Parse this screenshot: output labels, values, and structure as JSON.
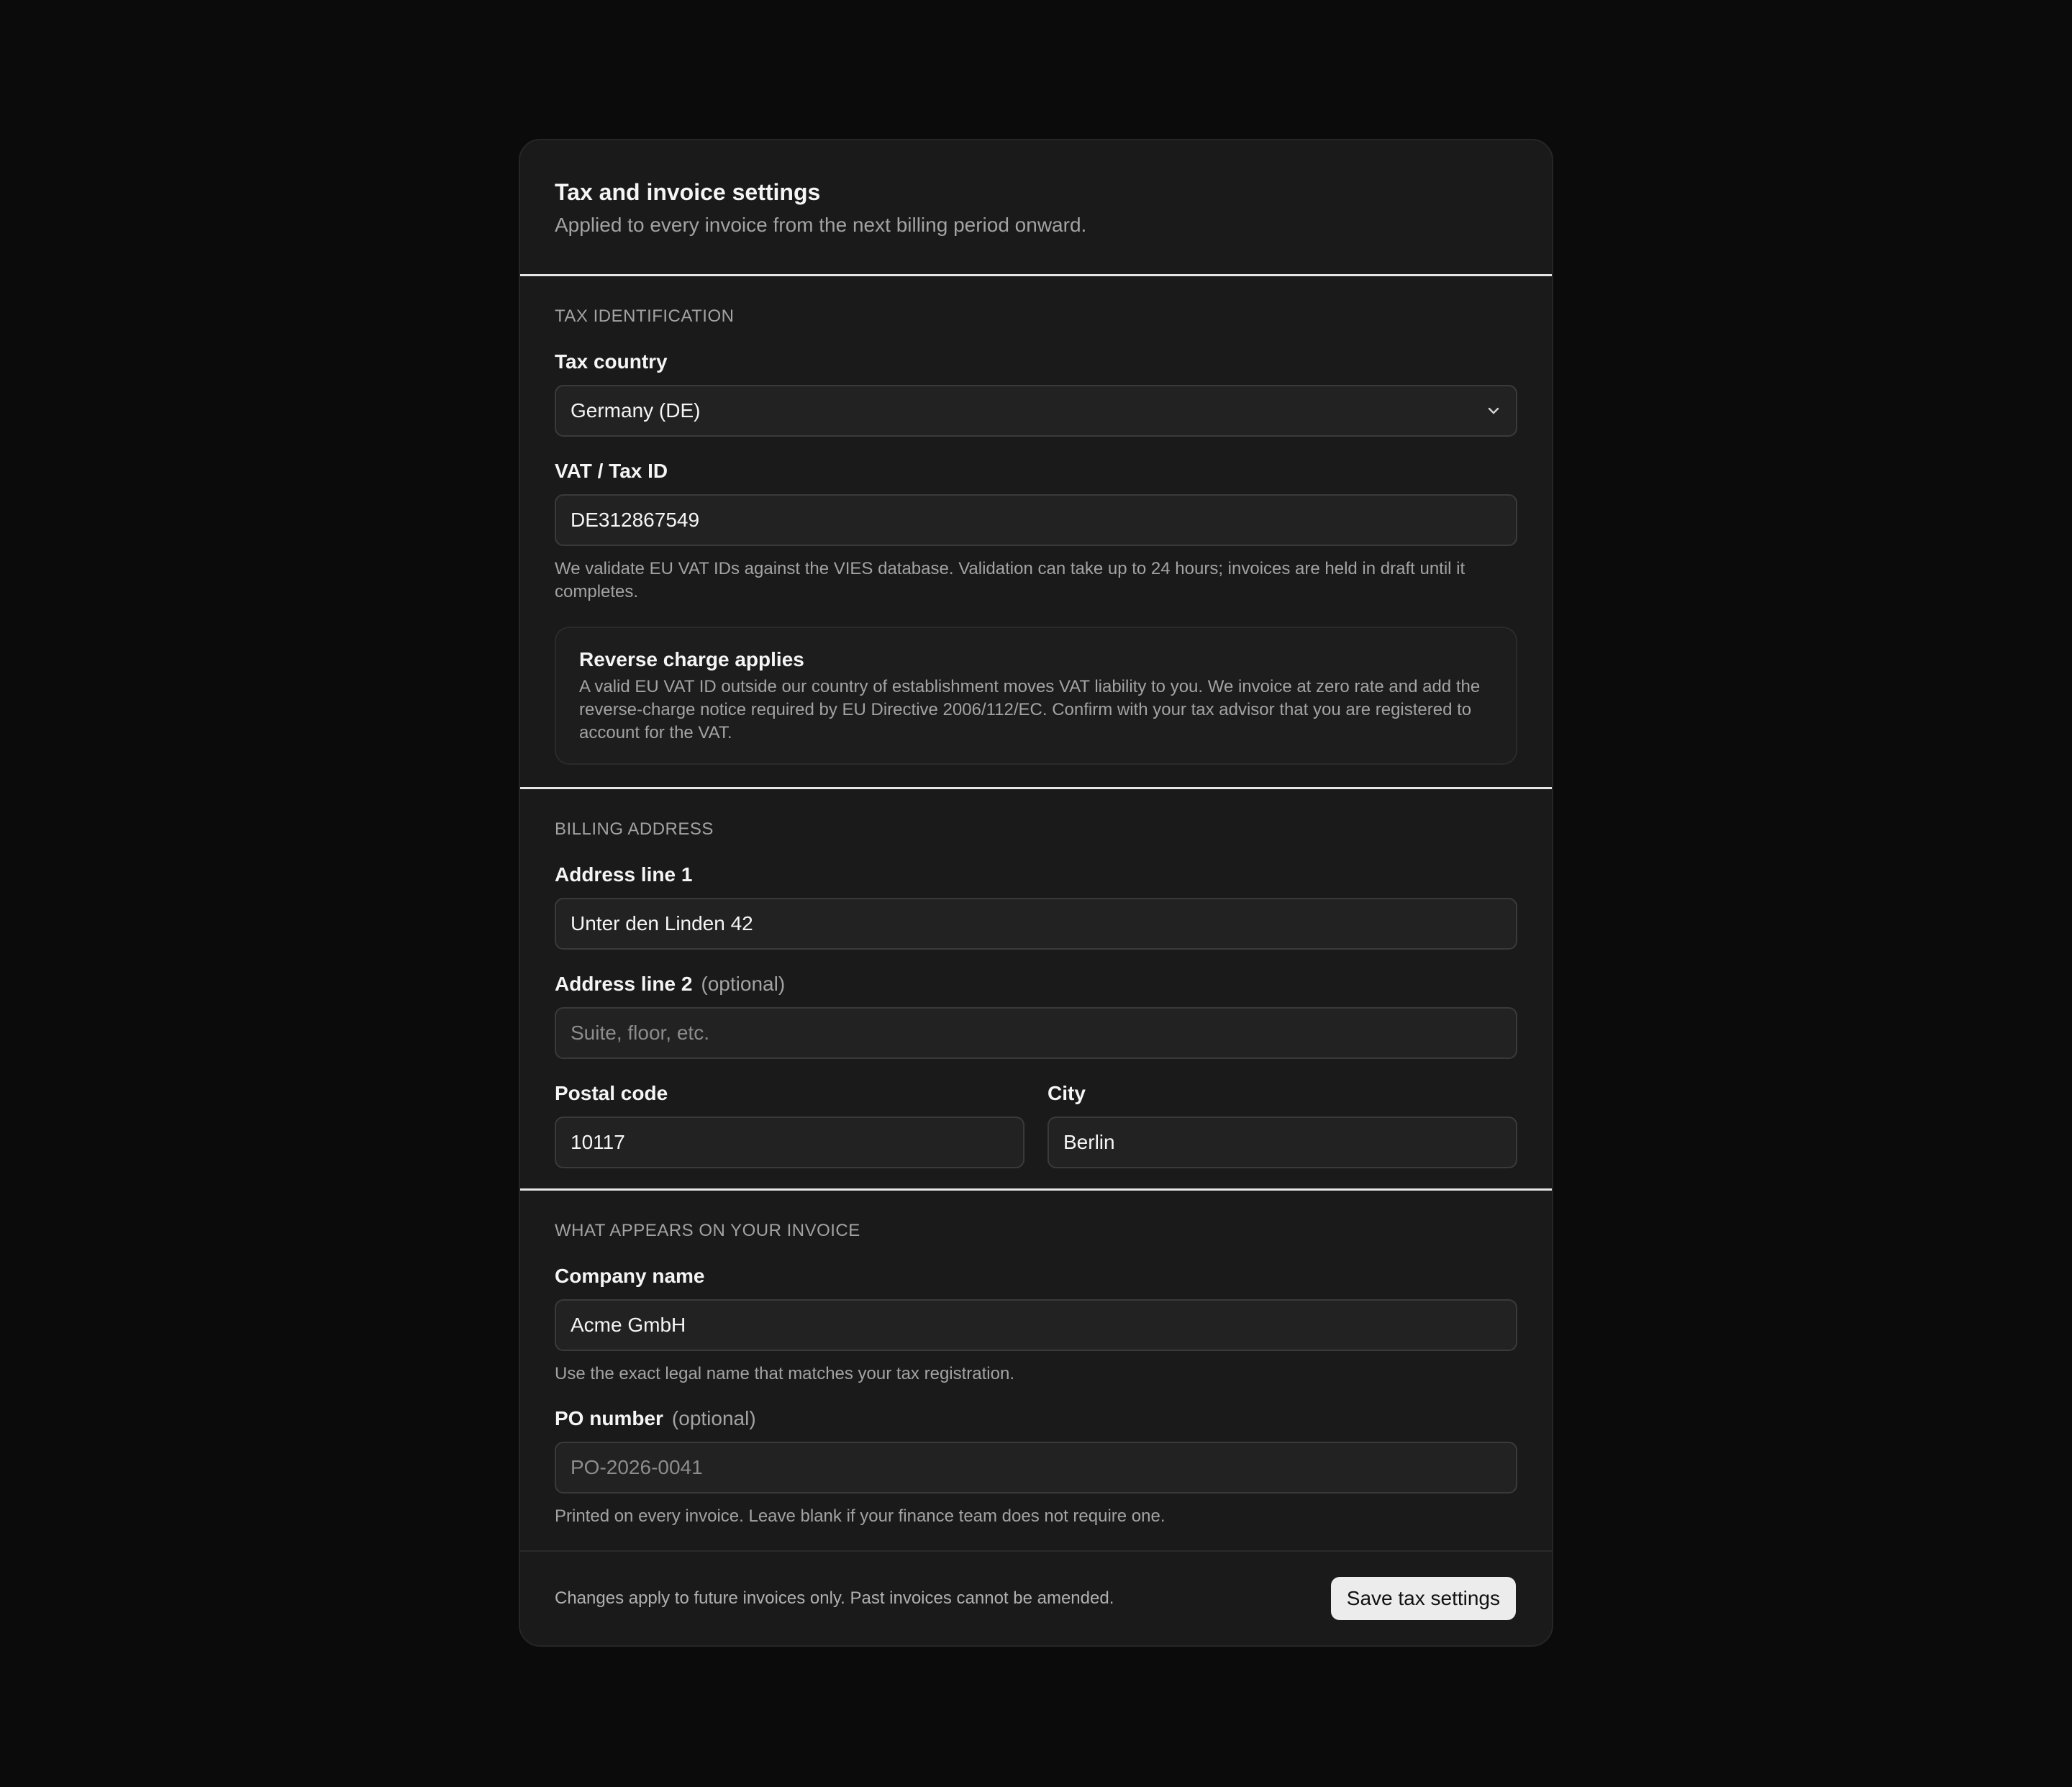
{
  "header": {
    "title": "Tax and invoice settings",
    "subtitle": "Applied to every invoice from the next billing period onward."
  },
  "tax_identification": {
    "section_title": "TAX IDENTIFICATION",
    "tax_country": {
      "label": "Tax country",
      "value": "Germany (DE)",
      "icon": "chevron-down-icon"
    },
    "vat_id": {
      "label": "VAT / Tax ID",
      "value": "DE312867549",
      "help": "We validate EU VAT IDs against the VIES database. Validation can take up to 24 hours; invoices are held in draft until it completes."
    },
    "callout": {
      "title": "Reverse charge applies",
      "body": "A valid EU VAT ID outside our country of establishment moves VAT liability to you. We invoice at zero rate and add the reverse-charge notice required by EU Directive 2006/112/EC. Confirm with your tax advisor that you are registered to account for the VAT."
    }
  },
  "billing_address": {
    "section_title": "BILLING ADDRESS",
    "address_line_1": {
      "label": "Address line 1",
      "value": "Unter den Linden 42"
    },
    "address_line_2": {
      "label": "Address line 2",
      "optional": "(optional)",
      "value": "",
      "placeholder": "Suite, floor, etc."
    },
    "postal_code": {
      "label": "Postal code",
      "value": "10117"
    },
    "city": {
      "label": "City",
      "value": "Berlin"
    }
  },
  "invoice_display": {
    "section_title": "WHAT APPEARS ON YOUR INVOICE",
    "company_name": {
      "label": "Company name",
      "value": "Acme GmbH",
      "help": "Use the exact legal name that matches your tax registration."
    },
    "po_number": {
      "label": "PO number",
      "optional": "(optional)",
      "value": "",
      "placeholder": "PO-2026-0041",
      "help": "Printed on every invoice. Leave blank if your finance team does not require one."
    }
  },
  "footer": {
    "note": "Changes apply to future invoices only. Past invoices cannot be amended.",
    "save_label": "Save tax settings"
  }
}
